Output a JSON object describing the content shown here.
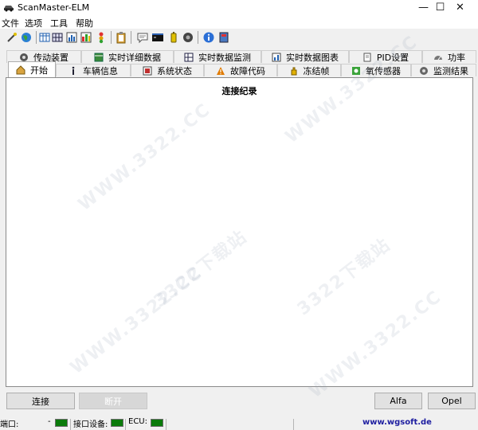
{
  "window": {
    "title": "ScanMaster-ELM",
    "minimize_glyph": "—",
    "maximize_glyph": "☐",
    "close_glyph": "✕"
  },
  "menu": [
    "文件",
    "选项",
    "工具",
    "帮助"
  ],
  "toolbar": {
    "icons": [
      "wand-icon",
      "globe-icon",
      "grid-icon",
      "bar-chart-icon",
      "color-chart-icon",
      "traffic-light-icon",
      "clipboard-icon",
      "chat-icon",
      "terminal-icon",
      "battery-icon",
      "gear-icon",
      "info-icon",
      "book-icon"
    ]
  },
  "tabs_top": [
    {
      "label": "传动装置",
      "icon": "gear-icon"
    },
    {
      "label": "实时详细数据",
      "icon": "table-icon"
    },
    {
      "label": "实时数据监测",
      "icon": "grid-icon"
    },
    {
      "label": "实时数据图表",
      "icon": "bar-chart-icon"
    },
    {
      "label": "PID设置",
      "icon": "document-icon"
    },
    {
      "label": "功率",
      "icon": "gauge-icon"
    }
  ],
  "tabs_bottom": [
    {
      "label": "开始",
      "icon": "home-icon",
      "active": true
    },
    {
      "label": "车辆信息",
      "icon": "info-icon"
    },
    {
      "label": "系统状态",
      "icon": "status-icon"
    },
    {
      "label": "故障代码",
      "icon": "warning-icon"
    },
    {
      "label": "冻结帧",
      "icon": "hand-icon"
    },
    {
      "label": "氧传感器",
      "icon": "sensor-icon"
    },
    {
      "label": "监测结果",
      "icon": "gear-icon"
    }
  ],
  "panel": {
    "title": "连接纪录"
  },
  "buttons": {
    "connect": "连接",
    "disconnect": "断开",
    "alfa": "Alfa",
    "opel": "Opel"
  },
  "statusbar": {
    "port_label": "端口:",
    "port_value": "-",
    "interface_label": "接口设备:",
    "ecu_label": "ECU:",
    "website": "www.wgsoft.de",
    "led_color": "#0a7a0a"
  },
  "watermark": {
    "lines": [
      "WWW.3322.CC",
      "3322下载站"
    ]
  }
}
